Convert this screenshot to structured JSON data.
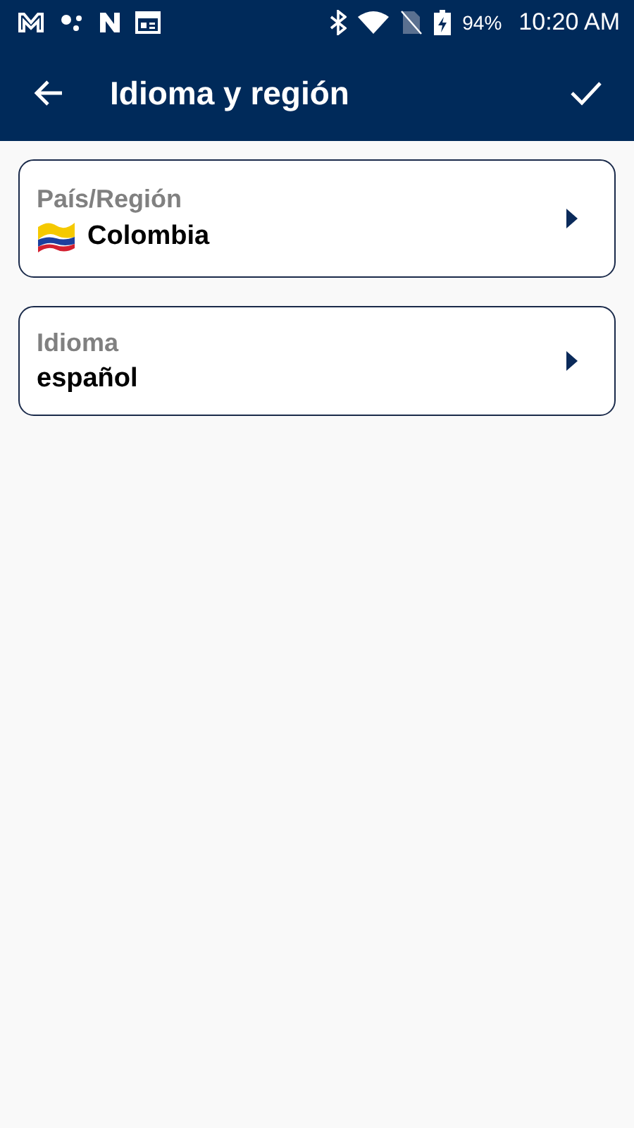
{
  "status_bar": {
    "battery": "94%",
    "time": "10:20 AM"
  },
  "app_bar": {
    "title": "Idioma y región"
  },
  "settings": [
    {
      "kind": "country",
      "label": "País/Región",
      "value": "Colombia"
    },
    {
      "kind": "text",
      "label": "Idioma",
      "value": "español"
    }
  ]
}
